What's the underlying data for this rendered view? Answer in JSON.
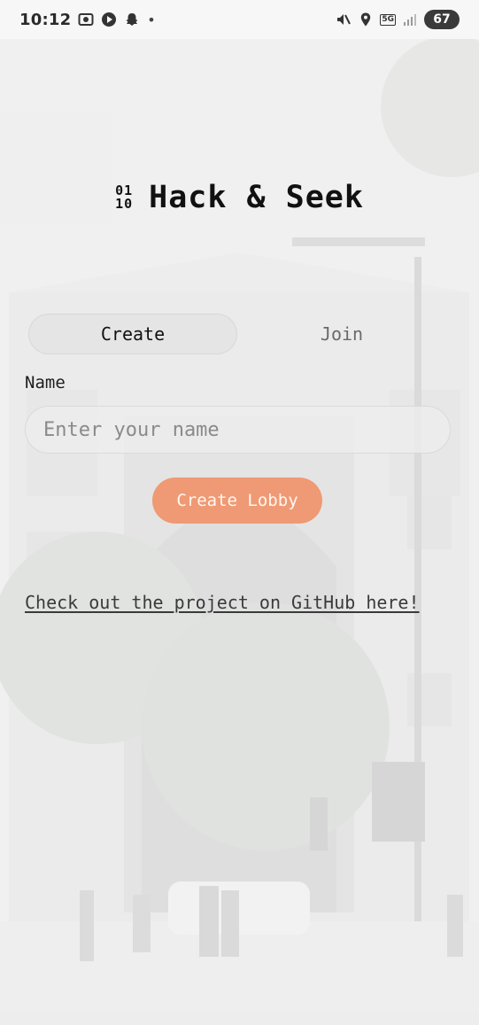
{
  "status_bar": {
    "time": "10:12",
    "dot": "•",
    "network": "5G",
    "battery": "67",
    "left_icons": [
      "screen-record-icon",
      "play-circle-icon",
      "snapchat-ghost-icon"
    ],
    "right_icons": [
      "mute-icon",
      "location-pin-icon",
      "signal-bars-icon"
    ]
  },
  "app": {
    "logo_top": "01",
    "logo_bottom": "10",
    "title": "Hack & Seek"
  },
  "tabs": [
    {
      "label": "Create",
      "active": true
    },
    {
      "label": "Join",
      "active": false
    }
  ],
  "form": {
    "name_label": "Name",
    "name_value": "",
    "name_placeholder": "Enter your name",
    "submit_label": "Create Lobby"
  },
  "footer": {
    "github_link_text": "Check out the project on GitHub here!"
  },
  "colors": {
    "accent": "#ef9a74",
    "background_veil": "#f8f8f8",
    "text": "#111111"
  }
}
